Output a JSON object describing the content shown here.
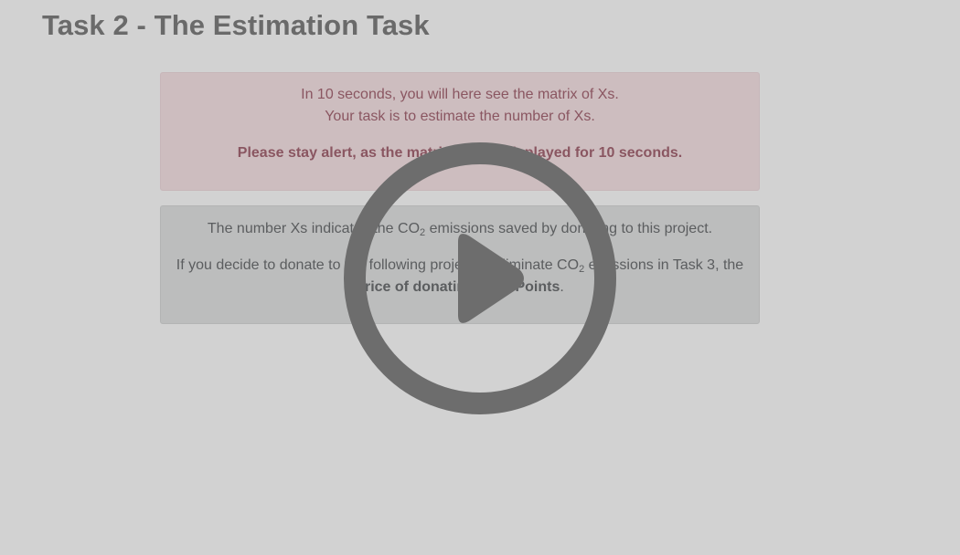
{
  "header": {
    "title": "Task 2 - The Estimation Task"
  },
  "notice": {
    "line1": "In 10 seconds, you will here see the matrix of Xs.",
    "line2": "Your task is to estimate the number of Xs.",
    "warning": "Please stay alert, as the matrix will be displayed for 10 seconds."
  },
  "info": {
    "p1_before": "The number Xs indicates the CO",
    "p1_sub": "2",
    "p1_after": " emissions saved by donating to this project.",
    "p2_before": "If you decide to donate to the following project to eliminate CO",
    "p2_sub": "2",
    "p2_mid": " emissions in Task 3, the ",
    "p2_bold": "price of donating is 85 Points",
    "p2_end": "."
  },
  "video": {
    "control_icon": "play-icon",
    "icon_color": "#6d6d6d"
  }
}
